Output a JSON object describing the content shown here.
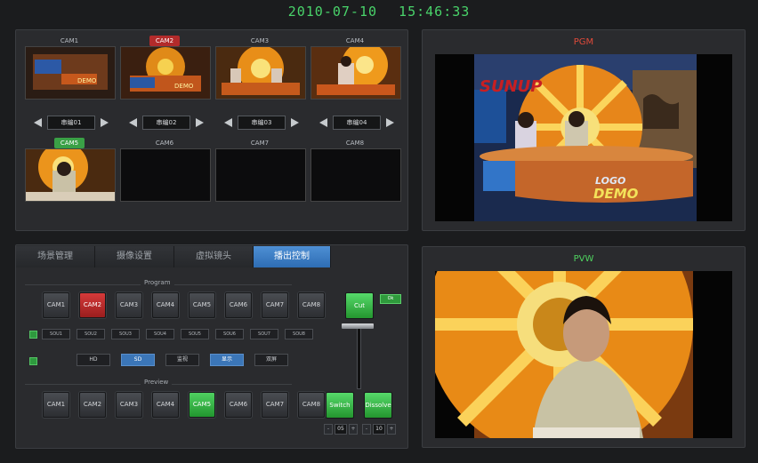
{
  "clock": {
    "date": "2010-07-10",
    "time": "15:46:33"
  },
  "cameras": [
    {
      "label": "CAM1",
      "source": "串编01"
    },
    {
      "label": "CAM2",
      "source": "串编02"
    },
    {
      "label": "CAM3",
      "source": "串编03"
    },
    {
      "label": "CAM4",
      "source": "串编04"
    },
    {
      "label": "CAM5"
    },
    {
      "label": "CAM6"
    },
    {
      "label": "CAM7"
    },
    {
      "label": "CAM8"
    }
  ],
  "tabs": [
    "场景管理",
    "摄像设置",
    "虚拟镜头",
    "播出控制"
  ],
  "active_tab": 3,
  "program": {
    "section_label": "Program",
    "buttons": [
      "CAM1",
      "CAM2",
      "CAM3",
      "CAM4",
      "CAM5",
      "CAM6",
      "CAM7",
      "CAM8"
    ],
    "active": "CAM2",
    "sources": [
      "SOU1",
      "SOU2",
      "SOU3",
      "SOU4",
      "SOU5",
      "SOU6",
      "SOU7",
      "SOU8"
    ]
  },
  "format_buttons": [
    "HD",
    "SD",
    "监视",
    "显示",
    "双屏"
  ],
  "format_active": [
    "SD",
    "显示"
  ],
  "preview": {
    "section_label": "Preview",
    "buttons": [
      "CAM1",
      "CAM2",
      "CAM3",
      "CAM4",
      "CAM5",
      "CAM6",
      "CAM7",
      "CAM8"
    ],
    "active": "CAM5"
  },
  "transitions": {
    "cut_label": "Cut",
    "ok_label": "Ok",
    "switch_label": "Switch",
    "dissolve_label": "Dissolve",
    "switch_value": "05",
    "dissolve_value": "10"
  },
  "monitors": {
    "pgm_label": "PGM",
    "pvw_label": "PVW",
    "pgm_color": "#e04a3a",
    "pvw_color": "#4fd35f"
  },
  "studio": {
    "logo_line1": "LOGO",
    "logo_line2": "DEMO",
    "banner": "SUNUP"
  }
}
